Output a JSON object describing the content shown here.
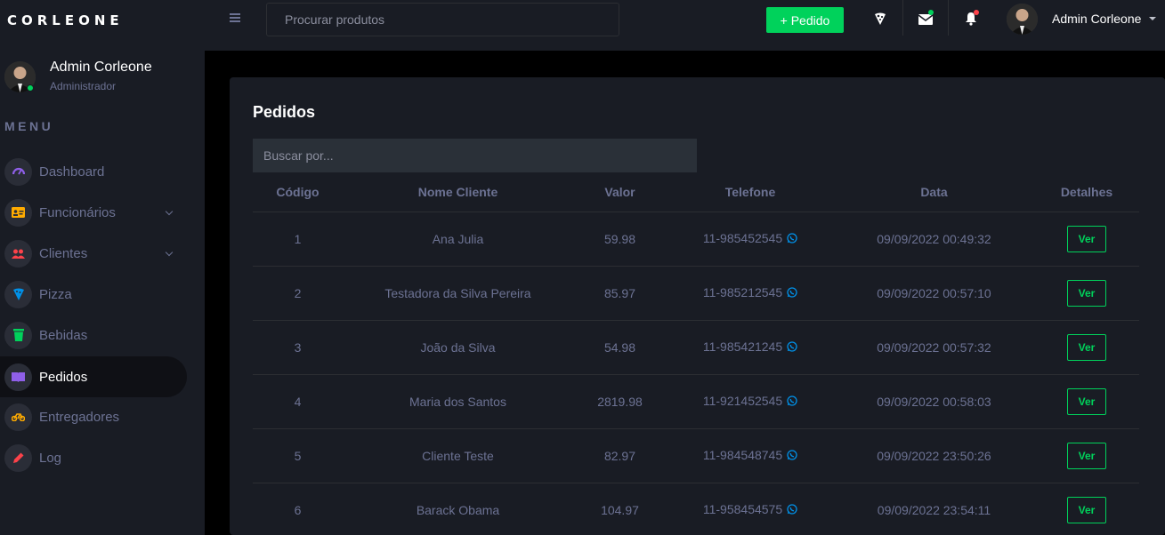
{
  "brand": "CORLEONE",
  "topbar": {
    "search_placeholder": "Procurar produtos",
    "new_order_label": "+ Pedido",
    "user_name": "Admin Corleone"
  },
  "colors": {
    "accent_green": "#00d25b",
    "notification_red": "#fc424a",
    "whatsapp_blue": "#0090e7",
    "bg_panel": "#191c24"
  },
  "sidebar": {
    "profile_name": "Admin Corleone",
    "profile_role": "Administrador",
    "menu_label": "MENU",
    "items": [
      {
        "label": "Dashboard",
        "icon": "speedometer-icon",
        "color": "#8f5fe8"
      },
      {
        "label": "Funcionários",
        "icon": "id-card-icon",
        "color": "#ffab00"
      },
      {
        "label": "Clientes",
        "icon": "users-icon",
        "color": "#fc424a"
      },
      {
        "label": "Pizza",
        "icon": "pizza-icon",
        "color": "#0090e7"
      },
      {
        "label": "Bebidas",
        "icon": "cup-icon",
        "color": "#00d25b"
      },
      {
        "label": "Pedidos",
        "icon": "book-icon",
        "color": "#8f5fe8"
      },
      {
        "label": "Entregadores",
        "icon": "motorbike-icon",
        "color": "#ffab00"
      },
      {
        "label": "Log",
        "icon": "pencil-icon",
        "color": "#fc424a"
      }
    ]
  },
  "main": {
    "title": "Pedidos",
    "search_placeholder": "Buscar por...",
    "columns": [
      "Código",
      "Nome Cliente",
      "Valor",
      "Telefone",
      "Data",
      "Detalhes"
    ],
    "button_label": "Ver",
    "rows": [
      {
        "codigo": "1",
        "nome": "Ana Julia",
        "valor": "59.98",
        "telefone": "11-985452545",
        "data": "09/09/2022 00:49:32"
      },
      {
        "codigo": "2",
        "nome": "Testadora da Silva Pereira",
        "valor": "85.97",
        "telefone": "11-985212545",
        "data": "09/09/2022 00:57:10"
      },
      {
        "codigo": "3",
        "nome": "João da Silva",
        "valor": "54.98",
        "telefone": "11-985421245",
        "data": "09/09/2022 00:57:32"
      },
      {
        "codigo": "4",
        "nome": "Maria dos Santos",
        "valor": "2819.98",
        "telefone": "11-921452545",
        "data": "09/09/2022 00:58:03"
      },
      {
        "codigo": "5",
        "nome": "Cliente Teste",
        "valor": "82.97",
        "telefone": "11-984548745",
        "data": "09/09/2022 23:50:26"
      },
      {
        "codigo": "6",
        "nome": "Barack Obama",
        "valor": "104.97",
        "telefone": "11-958454575",
        "data": "09/09/2022 23:54:11"
      }
    ]
  }
}
